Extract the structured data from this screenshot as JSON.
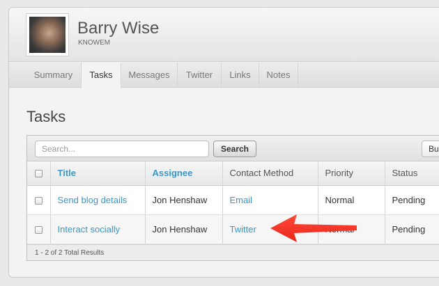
{
  "contact": {
    "name": "Barry Wise",
    "company": "KNOWEM"
  },
  "tabs": [
    {
      "label": "Summary",
      "active": false
    },
    {
      "label": "Tasks",
      "active": true
    },
    {
      "label": "Messages",
      "active": false
    },
    {
      "label": "Twitter",
      "active": false
    },
    {
      "label": "Links",
      "active": false
    },
    {
      "label": "Notes",
      "active": false
    }
  ],
  "section": {
    "title": "Tasks"
  },
  "toolbar": {
    "search_placeholder": "Search...",
    "search_button": "Search",
    "bulk_button": "Bu"
  },
  "table": {
    "columns": [
      "Title",
      "Assignee",
      "Contact Method",
      "Priority",
      "Status"
    ],
    "rows": [
      {
        "title": "Send blog details",
        "assignee": "Jon Henshaw",
        "contact_method": "Email",
        "priority": "Normal",
        "status": "Pending"
      },
      {
        "title": "Interact socially",
        "assignee": "Jon Henshaw",
        "contact_method": "Twitter",
        "priority": "Normal",
        "status": "Pending"
      }
    ]
  },
  "footer": {
    "results": "1 - 2 of 2 Total Results"
  },
  "annotation": {
    "arrow_color": "#e8261b"
  }
}
